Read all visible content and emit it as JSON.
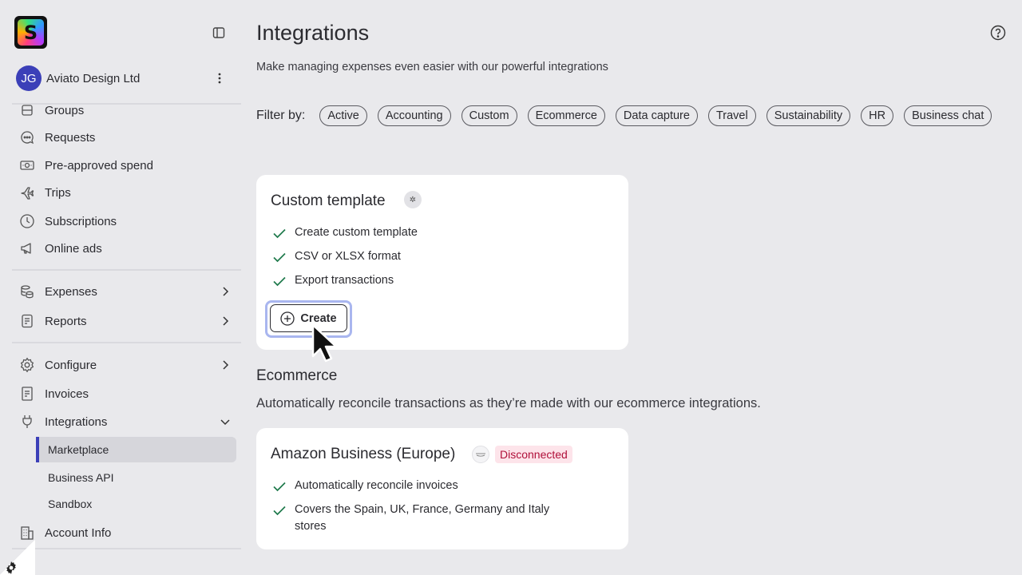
{
  "app": {
    "logo_letter": "S",
    "company": {
      "initials": "JG",
      "name": "Aviato Design Ltd"
    }
  },
  "sidebar": {
    "items": [
      {
        "label": "Groups",
        "icon": "groups-icon"
      },
      {
        "label": "Requests",
        "icon": "requests-icon"
      },
      {
        "label": "Pre-approved spend",
        "icon": "pre-approved-icon"
      },
      {
        "label": "Trips",
        "icon": "plane-icon"
      },
      {
        "label": "Subscriptions",
        "icon": "clock-icon"
      },
      {
        "label": "Online ads",
        "icon": "megaphone-icon"
      },
      {
        "label": "Expenses",
        "icon": "coins-icon"
      },
      {
        "label": "Reports",
        "icon": "reports-icon"
      },
      {
        "label": "Configure",
        "icon": "gear-icon"
      },
      {
        "label": "Invoices",
        "icon": "invoice-icon"
      },
      {
        "label": "Integrations",
        "icon": "plug-icon"
      },
      {
        "label": "Account Info",
        "icon": "building-icon"
      }
    ],
    "integrations_sub": [
      {
        "label": "Marketplace",
        "active": true
      },
      {
        "label": "Business API",
        "active": false
      },
      {
        "label": "Sandbox",
        "active": false
      }
    ]
  },
  "main": {
    "title": "Integrations",
    "subtitle": "Make managing expenses even easier with our powerful integrations",
    "filter_label": "Filter by:",
    "filters": [
      "Active",
      "Accounting",
      "Custom",
      "Ecommerce",
      "Data capture",
      "Travel",
      "Sustainability",
      "HR",
      "Business chat"
    ],
    "custom_card": {
      "title": "Custom template",
      "features": [
        "Create custom template",
        "CSV or XLSX format",
        "Export transactions"
      ],
      "button": "Create"
    },
    "ecommerce": {
      "title": "Ecommerce",
      "description": "Automatically reconcile transactions as they’re made with our ecommerce integrations.",
      "card": {
        "title": "Amazon Business (Europe)",
        "status": "Disconnected",
        "features": [
          "Automatically reconcile invoices",
          "Covers the Spain, UK, France, Germany and Italy stores"
        ]
      }
    }
  },
  "colors": {
    "background": "#e9e9ec",
    "accent": "#3b3fb8",
    "check": "#1f7a4c",
    "disconnected_bg": "#fde4ea",
    "disconnected_text": "#b0103a"
  }
}
